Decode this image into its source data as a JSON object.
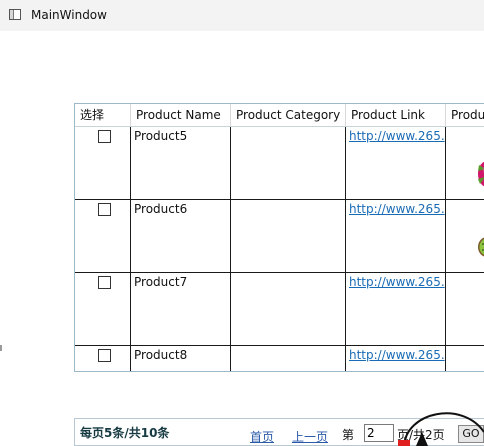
{
  "window": {
    "title": "MainWindow"
  },
  "table": {
    "headers": [
      "选择",
      "Product Name",
      "Product Category",
      "Product Link",
      "Produ"
    ],
    "rows": [
      {
        "name": "Product5",
        "category": "",
        "link": "http://www.265.",
        "image": "pitaya-fruit"
      },
      {
        "name": "Product6",
        "category": "",
        "link": "http://www.265.",
        "image": "kiwi-fruit"
      },
      {
        "name": "Product7",
        "category": "",
        "link": "http://www.265.",
        "image": ""
      },
      {
        "name": "Product8",
        "category": "",
        "link": "http://www.265.",
        "image": ""
      }
    ]
  },
  "pager": {
    "summary": "每页5条/共10条",
    "first": "首页",
    "prev": "上一页",
    "page_prefix": "第",
    "page_value": "2",
    "page_suffix": "页/共2页",
    "go": "GO"
  },
  "colors": {
    "link": "#1a6bb5",
    "grid_border": "#9db8c8",
    "pager_link": "#2a5aa8"
  }
}
